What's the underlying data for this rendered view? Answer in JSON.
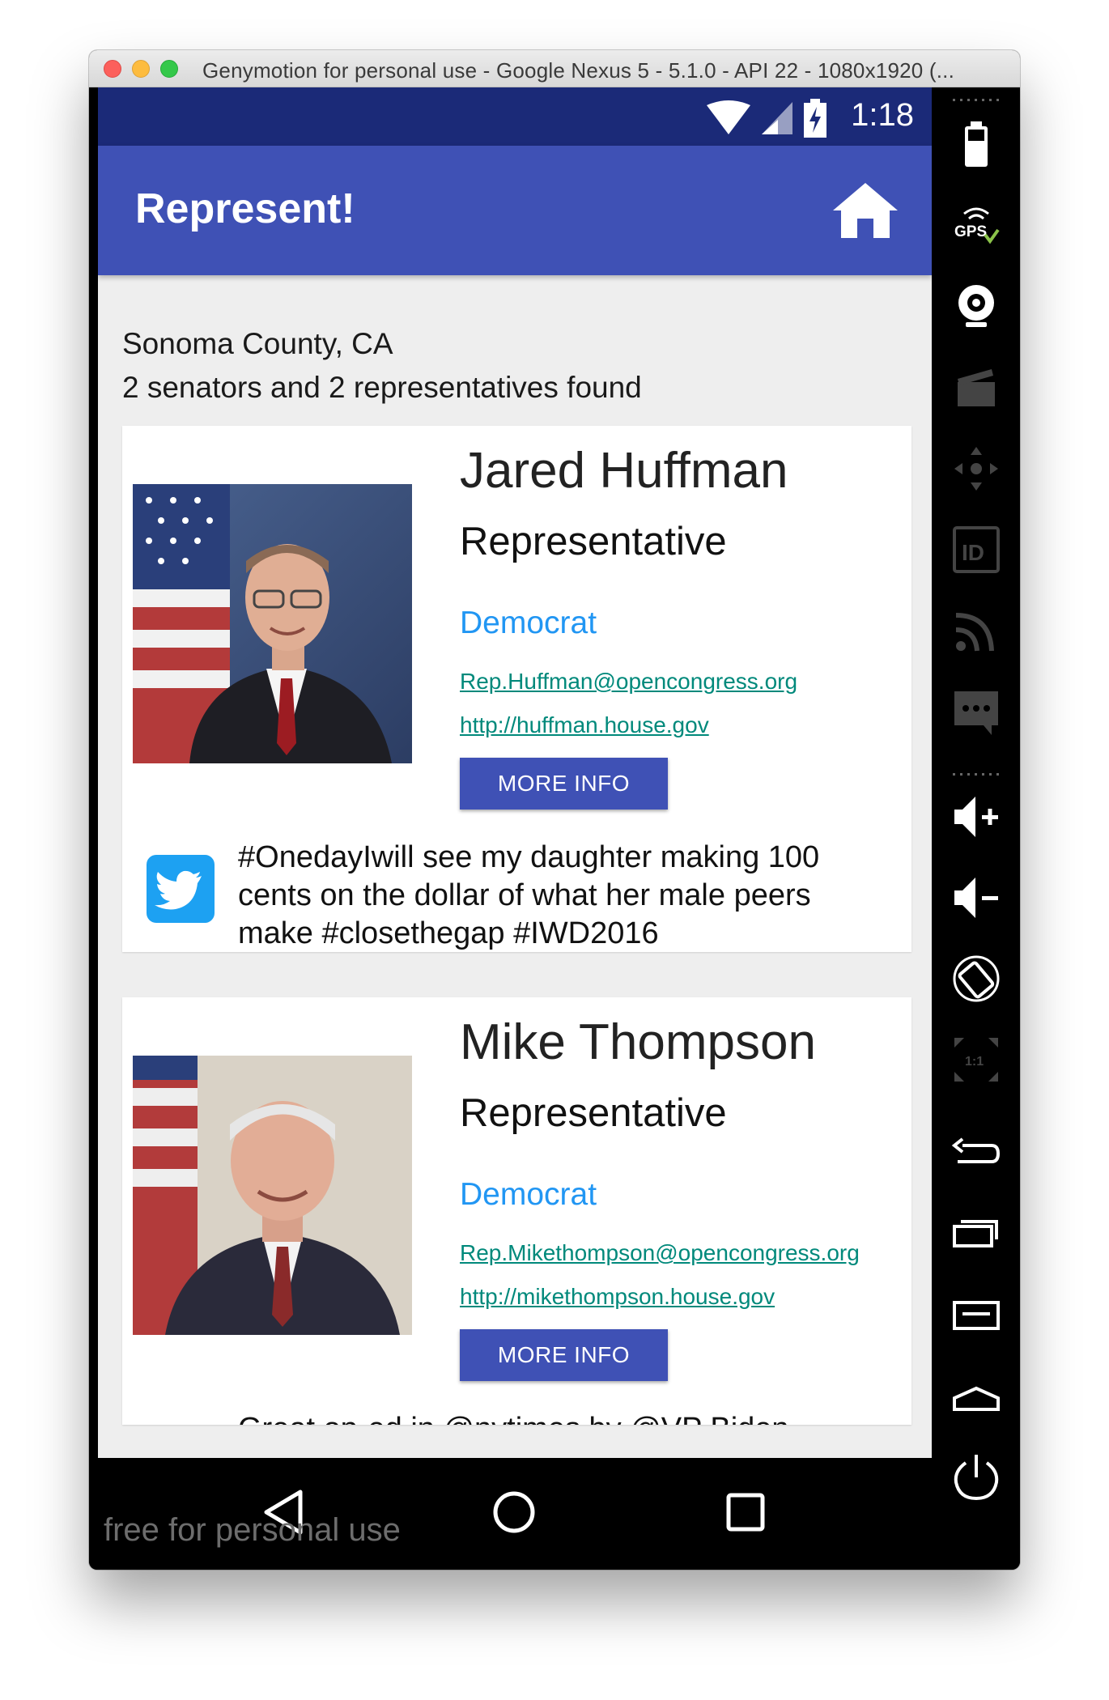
{
  "window": {
    "title": "Genymotion for personal use - Google Nexus 5 - 5.1.0 - API 22 - 1080x1920 (..."
  },
  "status_bar": {
    "time": "1:18"
  },
  "app_bar": {
    "title": "Represent!",
    "home_icon": "home-icon"
  },
  "location": {
    "county": "Sonoma County, CA",
    "summary": "2 senators and 2 representatives found"
  },
  "representatives": [
    {
      "name": "Jared Huffman",
      "role": "Representative",
      "party": "Democrat",
      "email": "Rep.Huffman@opencongress.org",
      "website": "http://huffman.house.gov",
      "button": "MORE INFO",
      "tweet": "#OnedayIwill see my daughter making 100 cents on the dollar of what her male peers make #closethegap #IWD2016"
    },
    {
      "name": "Mike Thompson",
      "role": "Representative",
      "party": "Democrat",
      "email": "Rep.Mikethompson@opencongress.org",
      "website": "http://mikethompson.house.gov",
      "button": "MORE INFO",
      "tweet": "Great op-ed in @nytimes by @VP Biden"
    }
  ],
  "watermark": "free for personal use",
  "colors": {
    "primary": "#3f51b5",
    "status_bar": "#1b2a78",
    "party": "#2196f3",
    "link": "#00897b",
    "twitter": "#1da1f2"
  },
  "sidebar_icons": [
    "battery-icon",
    "gps-icon",
    "webcam-icon",
    "clapperboard-icon",
    "dpad-icon",
    "id-icon",
    "signal-icon",
    "sms-icon",
    "volume-up-icon",
    "volume-down-icon",
    "rotate-icon",
    "pixel-perfect-icon",
    "back-icon",
    "recent-apps-icon",
    "menu-icon",
    "home-icon",
    "power-icon"
  ]
}
